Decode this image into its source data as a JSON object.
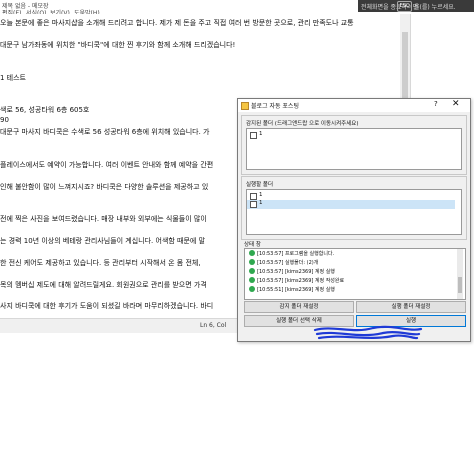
{
  "window": {
    "title": "제목 없음 - 메모장",
    "menu": [
      "편집(E)",
      "서식(O)",
      "보기(V)",
      "도움말(H)"
    ],
    "fullscreen_notice": {
      "text_before": "전체화면을 종료하려면",
      "key": "ESC",
      "text_after": "을(를) 누르세요."
    }
  },
  "editor": {
    "lines": [
      "오늘 본문에 좋은 마사지샵을 소개해 드리려고 합니다. 제가 제 돈을 주고 직접 여러 번 방문한 곳으로, 관리 만족도나 교통",
      "",
      "대문구 남가좌동에 위치한 \"바디쿡\"에 대한 찐 후기와 함께 소개해 드리겠습니다!",
      "",
      "",
      "1 테스트",
      "",
      "",
      "색로 56, 성공타워 6층 605호",
      "90",
      "대문구 마사지 바디쿡은 수색로 56 성공타워 6층에 위치해 있습니다. 가",
      "",
      "",
      "플레이스에서도 예약이 가능합니다. 여러 이벤트 안내와 함께 예약을 간편",
      "",
      "인해 불안함이 많이 느껴지시죠? 바디쿡은 다양한 솔루션을 제공하고 있",
      "",
      "",
      "전에 찍은 사진을 보여드렸습니다. 매장 내부와 외부에는 식물들이 많이",
      "",
      "는 경력 10년 이상의 베테랑 관리사님들이 계십니다. 어색함 때문에 말",
      "",
      "한 전신 케어도 제공하고 있습니다. 등 관리부터 시작해서 온 몸 전체,",
      "",
      "목의 멤버십 제도에 대해 알려드릴게요. 회원권으로 관리를 받으면 가격",
      "",
      "사지 바디쿡에 대한 후기가 도움이 되셨길 바라며 마무리하겠습니다. 바디"
    ],
    "status": "Ln 6, Col"
  },
  "dialog": {
    "title": "블로그 자동 포스팅",
    "help_label": "?",
    "close_label": "✕",
    "watch_folder_label": "감지된 폴더 (드래그앤드랍 으로 이동시켜주세요)",
    "watch_folder_items": [
      "1"
    ],
    "exec_folder_label": "실행할 폴더",
    "exec_folder_items": [
      "1",
      "1"
    ],
    "status_label": "상태 창",
    "log_lines": [
      "[10:53:57] 프로그램을 실행합니다.",
      "[10:53:57] 실행폴더: (2)개",
      "[10:53:57] [kims2369] 계정 실행",
      "[10:53:57] [kims2369] 계정 작성완료",
      "[10:55:51] [kims2369] 계정 실행"
    ],
    "buttons": {
      "watch_refresh": "감지 폴더 재설정",
      "exec_refresh": "실행 폴더 재설정",
      "exec_delete": "실행 폴더 선택 삭제",
      "run": "실행"
    }
  }
}
